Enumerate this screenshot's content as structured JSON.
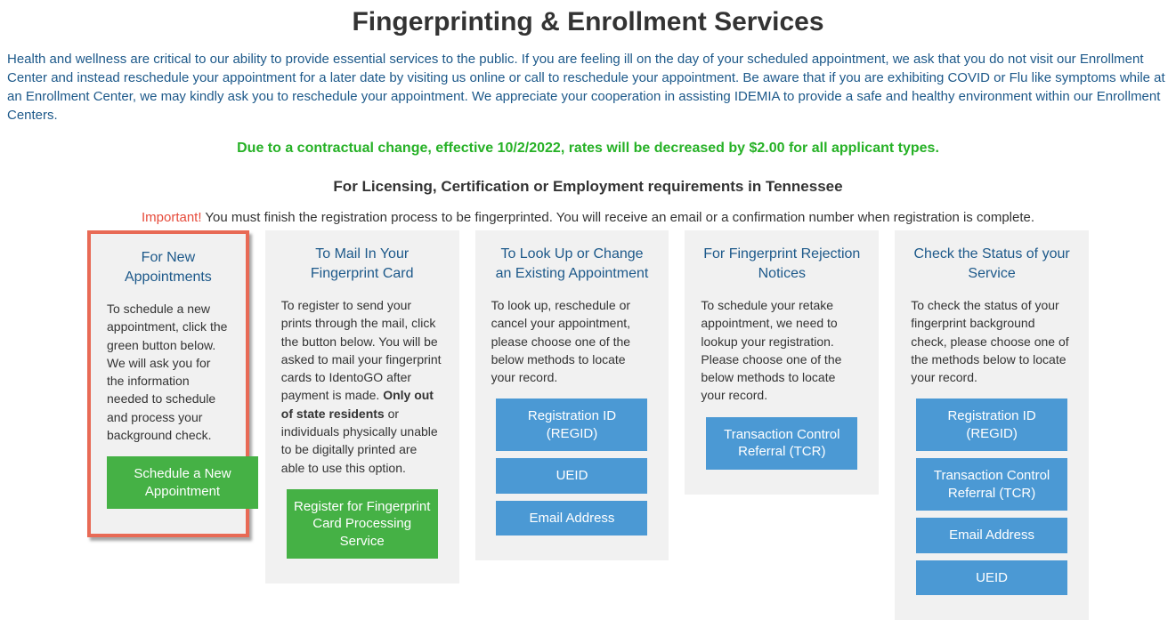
{
  "title": "Fingerprinting & Enrollment Services",
  "intro": "Health and wellness are critical to our ability to provide essential services to the public. If you are feeling ill on the day of your scheduled appointment, we ask that you do not visit our Enrollment Center and instead reschedule your appointment for a later date by visiting us online or call to reschedule your appointment. Be aware that if you are exhibiting COVID or Flu like symptoms while at an Enrollment Center, we may kindly ask you to reschedule your appointment. We appreciate your cooperation in assisting IDEMIA to provide a safe and healthy environment within our Enrollment Centers.",
  "rate_notice": "Due to a contractual change, effective 10/2/2022, rates will be decreased by $2.00 for all applicant types.",
  "subheading": "For Licensing, Certification or Employment requirements in Tennessee",
  "important_label": "Important!",
  "important_text": " You must finish the registration process to be fingerprinted. You will receive an email or a confirmation number when registration is complete.",
  "cards": {
    "new_appt": {
      "title": "For New Appointments",
      "text": "To schedule a new appointment, click the green button below. We will ask you for the information needed to schedule and process your background check.",
      "button": "Schedule a New Appointment"
    },
    "mail_in": {
      "title": "To Mail In Your Fingerprint Card",
      "text_pre": "To register to send your prints through the mail, click the button below. You will be asked to mail your fingerprint cards to IdentoGO after payment is made. ",
      "text_bold": "Only out of state residents",
      "text_post": " or individuals physically unable to be digitally printed are able to use this option.",
      "button": "Register for Fingerprint Card Processing Service"
    },
    "lookup": {
      "title": "To Look Up or Change an Existing Appointment",
      "text": "To look up, reschedule or cancel your appointment, please choose one of the below methods to locate your record.",
      "btn_regid": "Registration ID (REGID)",
      "btn_ueid": "UEID",
      "btn_email": "Email Address"
    },
    "rejection": {
      "title": "For Fingerprint Rejection Notices",
      "text": "To schedule your retake appointment, we need to lookup your registration. Please choose one of the below methods to locate your record.",
      "btn_tcr": "Transaction Control Referral (TCR)"
    },
    "status": {
      "title": "Check the Status of your Service",
      "text": "To check the status of your fingerprint background check, please choose one of the methods below to locate your record.",
      "btn_regid": "Registration ID (REGID)",
      "btn_tcr": "Transaction Control Referral (TCR)",
      "btn_email": "Email Address",
      "btn_ueid": "UEID"
    }
  }
}
